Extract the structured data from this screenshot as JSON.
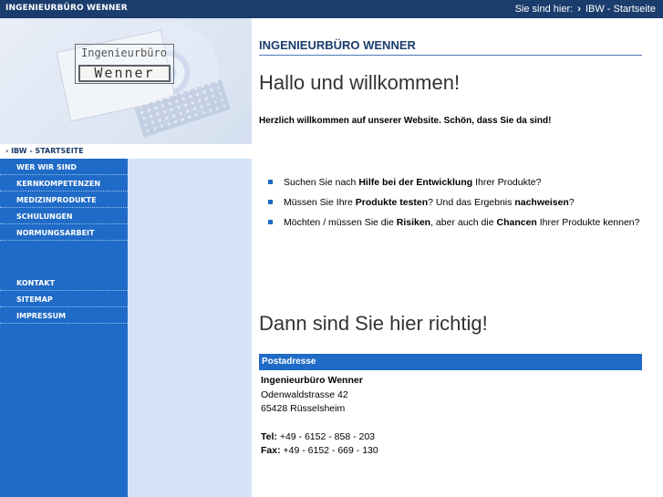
{
  "header": {
    "brand": "INGENIEURBÜRO WENNER",
    "breadcrumb_prefix": "Sie sind hier:",
    "breadcrumb_separator": "›",
    "breadcrumb_current": "IBW - Startseite"
  },
  "logo": {
    "top": "Ingenieurbüro",
    "bottom": "Wenner"
  },
  "nav": {
    "current": "› IBW - STARTSEITE",
    "items": [
      {
        "label": "WER WIR SIND"
      },
      {
        "label": "KERNKOMPETENZEN"
      },
      {
        "label": "MEDIZINPRODUKTE"
      },
      {
        "label": "SCHULUNGEN"
      },
      {
        "label": "NORMUNGSARBEIT"
      },
      {
        "label": "KONTAKT"
      },
      {
        "label": "SITEMAP"
      },
      {
        "label": "IMPRESSUM"
      }
    ]
  },
  "main": {
    "site_title": "INGENIEURBÜRO WENNER",
    "hello": "Hallo und willkommen!",
    "welcome": "Herzlich willkommen auf unserer Website. Schön, dass Sie da sind!",
    "bullets": [
      {
        "a": "Suchen Sie nach ",
        "b": "Hilfe bei der Entwicklung",
        "c": " Ihrer Produkte?"
      },
      {
        "a": "Müssen Sie Ihre ",
        "b": "Produkte testen",
        "c": "? Und das Ergebnis ",
        "d": "nachweisen",
        "e": "?"
      },
      {
        "a": "Möchten / müssen Sie die ",
        "b": "Risiken",
        "c": ", aber auch die ",
        "d": "Chancen",
        "e": " Ihrer Produkte kennen?"
      }
    ],
    "dann": "Dann sind Sie hier richtig!"
  },
  "address": {
    "heading": "Postadresse",
    "company": "Ingenieurbüro Wenner",
    "street": "Odenwaldstrasse 42",
    "city": "65428 Rüsselsheim",
    "tel_label": "Tel:",
    "tel": "+49 - 6152 - 858 - 203",
    "fax_label": "Fax:",
    "fax": "+49 - 6152 - 669 - 130"
  },
  "colors": {
    "top_bar": "#1b3d6d",
    "nav_blue": "#1f6bc7",
    "side_light": "#d5e3fa"
  }
}
